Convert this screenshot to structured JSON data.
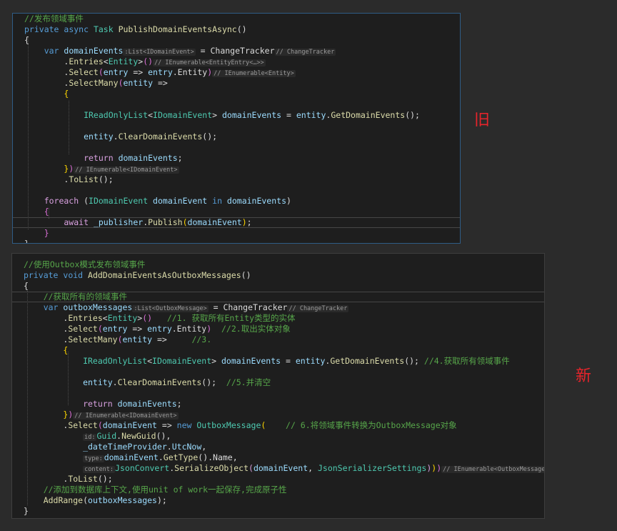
{
  "old": {
    "badge": "旧",
    "lines": [
      [
        {
          "t": "//发布领域事件",
          "c": "c"
        }
      ],
      [
        {
          "t": "private ",
          "c": "k"
        },
        {
          "t": "async ",
          "c": "k"
        },
        {
          "t": "Task ",
          "c": "t"
        },
        {
          "t": "PublishDomainEventsAsync",
          "c": "m"
        },
        {
          "t": "()",
          "c": "plain"
        }
      ],
      [
        {
          "t": "{",
          "c": "plain"
        }
      ],
      [
        {
          "t": "    var ",
          "c": "k"
        },
        {
          "t": "domainEvents",
          "c": "v"
        },
        {
          "t": ":List<IDomainEvent>",
          "c": "hint"
        },
        {
          "t": " = ChangeTracker",
          "c": "plain"
        },
        {
          "t": "// ChangeTracker",
          "c": "hint"
        }
      ],
      [
        {
          "t": "        .",
          "c": "plain"
        },
        {
          "t": "Entries",
          "c": "m"
        },
        {
          "t": "<",
          "c": "plain"
        },
        {
          "t": "Entity",
          "c": "t"
        },
        {
          "t": ">",
          "c": "plain"
        },
        {
          "t": "()",
          "c": "br"
        },
        {
          "t": "// IEnumerable<EntityEntry<…>>",
          "c": "hint"
        }
      ],
      [
        {
          "t": "        .",
          "c": "plain"
        },
        {
          "t": "Select",
          "c": "m"
        },
        {
          "t": "(",
          "c": "br"
        },
        {
          "t": "entry",
          "c": "v"
        },
        {
          "t": " => ",
          "c": "plain"
        },
        {
          "t": "entry",
          "c": "v"
        },
        {
          "t": ".Entity",
          "c": "plain"
        },
        {
          "t": ")",
          "c": "br"
        },
        {
          "t": "// IEnumerable<Entity>",
          "c": "hint"
        }
      ],
      [
        {
          "t": "        .",
          "c": "plain"
        },
        {
          "t": "SelectMany",
          "c": "m"
        },
        {
          "t": "(",
          "c": "br"
        },
        {
          "t": "entity",
          "c": "v"
        },
        {
          "t": " =>",
          "c": "plain"
        }
      ],
      [
        {
          "t": "        {",
          "c": "b2"
        }
      ],
      [],
      [
        {
          "t": "            IReadOnlyList",
          "c": "t"
        },
        {
          "t": "<",
          "c": "plain"
        },
        {
          "t": "IDomainEvent",
          "c": "t"
        },
        {
          "t": "> ",
          "c": "plain"
        },
        {
          "t": "domainEvents",
          "c": "v"
        },
        {
          "t": " = ",
          "c": "plain"
        },
        {
          "t": "entity",
          "c": "v"
        },
        {
          "t": ".",
          "c": "plain"
        },
        {
          "t": "GetDomainEvents",
          "c": "m"
        },
        {
          "t": "();",
          "c": "plain"
        }
      ],
      [],
      [
        {
          "t": "            entity",
          "c": "v"
        },
        {
          "t": ".",
          "c": "plain"
        },
        {
          "t": "ClearDomainEvents",
          "c": "m"
        },
        {
          "t": "();",
          "c": "plain"
        }
      ],
      [],
      [
        {
          "t": "            return ",
          "c": "pk"
        },
        {
          "t": "domainEvents",
          "c": "v"
        },
        {
          "t": ";",
          "c": "plain"
        }
      ],
      [
        {
          "t": "        }",
          "c": "b2"
        },
        {
          "t": ")",
          "c": "br"
        },
        {
          "t": "// IEnumerable<IDomainEvent>",
          "c": "hint"
        }
      ],
      [
        {
          "t": "        .",
          "c": "plain"
        },
        {
          "t": "ToList",
          "c": "m"
        },
        {
          "t": "();",
          "c": "plain"
        }
      ],
      [],
      [
        {
          "t": "    foreach ",
          "c": "pk"
        },
        {
          "t": "(",
          "c": "plain"
        },
        {
          "t": "IDomainEvent ",
          "c": "t"
        },
        {
          "t": "domainEvent ",
          "c": "v"
        },
        {
          "t": "in ",
          "c": "k"
        },
        {
          "t": "domainEvents",
          "c": "v"
        },
        {
          "t": ")",
          "c": "plain"
        }
      ],
      [
        {
          "t": "    {",
          "c": "br"
        }
      ],
      [
        {
          "t": "        await ",
          "c": "pk"
        },
        {
          "t": "_publisher",
          "c": "v"
        },
        {
          "t": ".",
          "c": "plain"
        },
        {
          "t": "Publish",
          "c": "m"
        },
        {
          "t": "(",
          "c": "b2"
        },
        {
          "t": "domainEvent",
          "c": "v"
        },
        {
          "t": ")",
          "c": "b2"
        },
        {
          "t": ";",
          "c": "plain"
        }
      ],
      [
        {
          "t": "    }",
          "c": "br"
        }
      ],
      [
        {
          "t": "}",
          "c": "plain"
        }
      ]
    ]
  },
  "new": {
    "badge": "新",
    "lines": [
      [
        {
          "t": "//使用Outbox模式发布领域事件",
          "c": "c"
        }
      ],
      [
        {
          "t": "private ",
          "c": "k"
        },
        {
          "t": "void ",
          "c": "k"
        },
        {
          "t": "AddDomainEventsAsOutboxMessages",
          "c": "m"
        },
        {
          "t": "()",
          "c": "plain"
        }
      ],
      [
        {
          "t": "{",
          "c": "plain"
        }
      ],
      [
        {
          "t": "    //获取所有的领域事件",
          "c": "c"
        }
      ],
      [
        {
          "t": "    var ",
          "c": "k"
        },
        {
          "t": "outboxMessages",
          "c": "v"
        },
        {
          "t": ":List<OutboxMessage>",
          "c": "hint"
        },
        {
          "t": " = ChangeTracker",
          "c": "plain"
        },
        {
          "t": "// ChangeTracker",
          "c": "hint"
        }
      ],
      [
        {
          "t": "        .",
          "c": "plain"
        },
        {
          "t": "Entries",
          "c": "m"
        },
        {
          "t": "<",
          "c": "plain"
        },
        {
          "t": "Entity",
          "c": "t"
        },
        {
          "t": ">",
          "c": "plain"
        },
        {
          "t": "()",
          "c": "br"
        },
        {
          "t": "   //1. 获取所有Entity类型的实体",
          "c": "c"
        }
      ],
      [
        {
          "t": "        .",
          "c": "plain"
        },
        {
          "t": "Select",
          "c": "m"
        },
        {
          "t": "(",
          "c": "br"
        },
        {
          "t": "entry",
          "c": "v"
        },
        {
          "t": " => ",
          "c": "plain"
        },
        {
          "t": "entry",
          "c": "v"
        },
        {
          "t": ".Entity",
          "c": "plain"
        },
        {
          "t": ")",
          "c": "br"
        },
        {
          "t": "  //2.取出实体对象",
          "c": "c"
        }
      ],
      [
        {
          "t": "        .",
          "c": "plain"
        },
        {
          "t": "SelectMany",
          "c": "m"
        },
        {
          "t": "(",
          "c": "br"
        },
        {
          "t": "entity",
          "c": "v"
        },
        {
          "t": " =>     ",
          "c": "plain"
        },
        {
          "t": "//3.",
          "c": "c"
        }
      ],
      [
        {
          "t": "        {",
          "c": "b2"
        }
      ],
      [
        {
          "t": "            IReadOnlyList",
          "c": "t"
        },
        {
          "t": "<",
          "c": "plain"
        },
        {
          "t": "IDomainEvent",
          "c": "t"
        },
        {
          "t": "> ",
          "c": "plain"
        },
        {
          "t": "domainEvents",
          "c": "v"
        },
        {
          "t": " = ",
          "c": "plain"
        },
        {
          "t": "entity",
          "c": "v"
        },
        {
          "t": ".",
          "c": "plain"
        },
        {
          "t": "GetDomainEvents",
          "c": "m"
        },
        {
          "t": "(); ",
          "c": "plain"
        },
        {
          "t": "//4.获取所有领域事件",
          "c": "c"
        }
      ],
      [],
      [
        {
          "t": "            entity",
          "c": "v"
        },
        {
          "t": ".",
          "c": "plain"
        },
        {
          "t": "ClearDomainEvents",
          "c": "m"
        },
        {
          "t": "();  ",
          "c": "plain"
        },
        {
          "t": "//5.并清空",
          "c": "c"
        }
      ],
      [],
      [
        {
          "t": "            return ",
          "c": "pk"
        },
        {
          "t": "domainEvents",
          "c": "v"
        },
        {
          "t": ";",
          "c": "plain"
        }
      ],
      [
        {
          "t": "        }",
          "c": "b2"
        },
        {
          "t": ")",
          "c": "br"
        },
        {
          "t": "// IEnumerable<IDomainEvent>",
          "c": "hint"
        }
      ],
      [
        {
          "t": "        .",
          "c": "plain"
        },
        {
          "t": "Select",
          "c": "m"
        },
        {
          "t": "(",
          "c": "br"
        },
        {
          "t": "domainEvent",
          "c": "v"
        },
        {
          "t": " => ",
          "c": "plain"
        },
        {
          "t": "new ",
          "c": "k"
        },
        {
          "t": "OutboxMessage",
          "c": "t"
        },
        {
          "t": "(",
          "c": "b2"
        },
        {
          "t": "    // 6.将领域事件转换为OutboxMessage对象",
          "c": "c"
        }
      ],
      [
        {
          "t": "            ",
          "c": "plain"
        },
        {
          "t": "id:",
          "c": "hint"
        },
        {
          "t": "Guid",
          "c": "t"
        },
        {
          "t": ".",
          "c": "plain"
        },
        {
          "t": "NewGuid",
          "c": "m"
        },
        {
          "t": "(),",
          "c": "plain"
        }
      ],
      [
        {
          "t": "            _dateTimeProvider",
          "c": "v"
        },
        {
          "t": ".",
          "c": "plain"
        },
        {
          "t": "UtcNow",
          "c": "v"
        },
        {
          "t": ",",
          "c": "plain"
        }
      ],
      [
        {
          "t": "            ",
          "c": "plain"
        },
        {
          "t": "type:",
          "c": "hint"
        },
        {
          "t": "domainEvent",
          "c": "v"
        },
        {
          "t": ".",
          "c": "plain"
        },
        {
          "t": "GetType",
          "c": "m"
        },
        {
          "t": "().Name,",
          "c": "plain"
        }
      ],
      [
        {
          "t": "            ",
          "c": "plain"
        },
        {
          "t": "content:",
          "c": "hint"
        },
        {
          "t": "JsonConvert",
          "c": "t"
        },
        {
          "t": ".",
          "c": "plain"
        },
        {
          "t": "SerializeObject",
          "c": "m"
        },
        {
          "t": "(",
          "c": "pk"
        },
        {
          "t": "domainEvent",
          "c": "v"
        },
        {
          "t": ", ",
          "c": "plain"
        },
        {
          "t": "JsonSerializerSettings",
          "c": "t"
        },
        {
          "t": ")",
          "c": "pk"
        },
        {
          "t": ")",
          "c": "b2"
        },
        {
          "t": ")",
          "c": "br"
        },
        {
          "t": "// IEnumerable<OutboxMessage>",
          "c": "hint"
        }
      ],
      [
        {
          "t": "        .",
          "c": "plain"
        },
        {
          "t": "ToList",
          "c": "m"
        },
        {
          "t": "();",
          "c": "plain"
        }
      ],
      [
        {
          "t": "    //添加到数据库上下文,使用unit of work一起保存,完成原子性",
          "c": "c"
        }
      ],
      [
        {
          "t": "    AddRange",
          "c": "m"
        },
        {
          "t": "(",
          "c": "plain"
        },
        {
          "t": "outboxMessages",
          "c": "v"
        },
        {
          "t": ");",
          "c": "plain"
        }
      ],
      [
        {
          "t": "}",
          "c": "plain"
        }
      ]
    ]
  }
}
